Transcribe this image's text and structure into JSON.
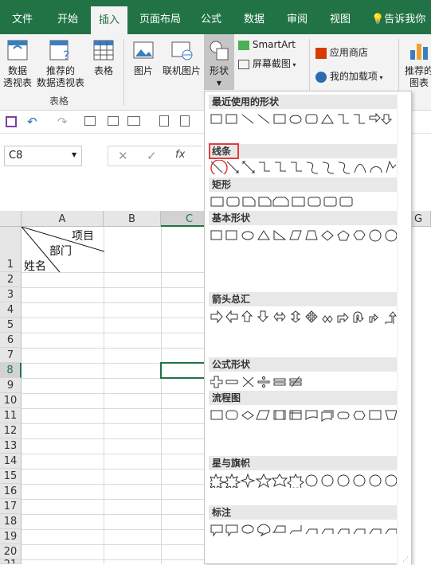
{
  "tabs": [
    "文件",
    "开始",
    "插入",
    "页面布局",
    "公式",
    "数据",
    "审阅",
    "视图",
    "告诉我你想"
  ],
  "ribbon": {
    "pivot": [
      "数据",
      "透视表"
    ],
    "rec_pivot": [
      "推荐的",
      "数据透视表"
    ],
    "table": "表格",
    "group_label": "表格",
    "picture": "图片",
    "online_picture": "联机图片",
    "shapes": "形状",
    "smartart": "SmartArt",
    "screenshot": "屏幕截图",
    "store": "应用商店",
    "my_addins": "我的加载项",
    "rec_chart": [
      "推荐的",
      "图表"
    ]
  },
  "formula": {
    "namebox": "C8",
    "fx": "fx"
  },
  "columns": [
    "A",
    "B",
    "C",
    "G"
  ],
  "rows": [
    "1",
    "2",
    "3",
    "4",
    "5",
    "6",
    "7",
    "8",
    "9",
    "10",
    "11",
    "12",
    "13",
    "14",
    "15",
    "16",
    "17",
    "18",
    "19",
    "20",
    "21"
  ],
  "cell_a1": {
    "item": "项目",
    "dept": "部门",
    "name": "姓名"
  },
  "shapes_panel": {
    "sections": [
      "最近使用的形状",
      "线条",
      "矩形",
      "基本形状",
      "箭头总汇",
      "公式形状",
      "流程图",
      "星与旗帜",
      "标注"
    ]
  },
  "colors": {
    "accent": "#217346",
    "highlight": "#e23d3d"
  }
}
